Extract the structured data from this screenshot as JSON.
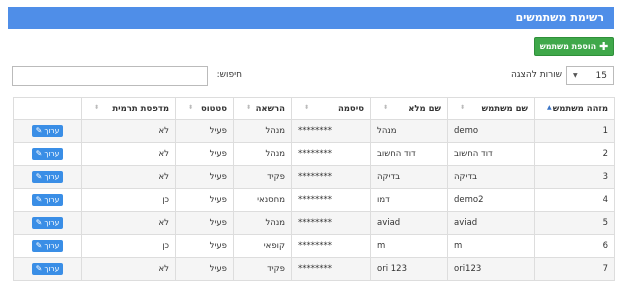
{
  "panel": {
    "title": "רשימת משתמשים"
  },
  "toolbar": {
    "add_user_label": "הוספת משתמש",
    "add_icon": "plus-icon"
  },
  "controls": {
    "rows_per_page_value": "15",
    "rows_per_page_label": "שורות להצגה",
    "search_label": "חיפוש:",
    "search_value": ""
  },
  "table": {
    "columns": [
      "מזהה משתמש",
      "שם משתמש",
      "שם מלא",
      "סיסמה",
      "הרשאה",
      "סטטוס",
      "מדפסת תרמית",
      ""
    ],
    "edit_label": "ערוך",
    "rows": [
      {
        "id": "1",
        "username": "demo",
        "full_name": "מנהל",
        "password": "********",
        "role": "מנהל",
        "status": "פעיל",
        "printer": "לא"
      },
      {
        "id": "2",
        "username": "דוד החשוב",
        "full_name": "דוד החשוב",
        "password": "********",
        "role": "מנהל",
        "status": "פעיל",
        "printer": "לא"
      },
      {
        "id": "3",
        "username": "בדיקה",
        "full_name": "בדיקה",
        "password": "********",
        "role": "פקיד",
        "status": "פעיל",
        "printer": "לא"
      },
      {
        "id": "4",
        "username": "demo2",
        "full_name": "דמו",
        "password": "********",
        "role": "מחסנאי",
        "status": "פעיל",
        "printer": "כן"
      },
      {
        "id": "5",
        "username": "aviad",
        "full_name": "aviad",
        "password": "********",
        "role": "מנהל",
        "status": "פעיל",
        "printer": "לא"
      },
      {
        "id": "6",
        "username": "m",
        "full_name": "m",
        "password": "********",
        "role": "קופאי",
        "status": "פעיל",
        "printer": "כן"
      },
      {
        "id": "7",
        "username": "ori123",
        "full_name": "ori 123",
        "password": "********",
        "role": "פקיד",
        "status": "פעיל",
        "printer": "לא"
      }
    ]
  },
  "colors": {
    "header": "#4f8ee8",
    "add_button": "#3fa84a",
    "edit_button": "#3a8ee6"
  }
}
